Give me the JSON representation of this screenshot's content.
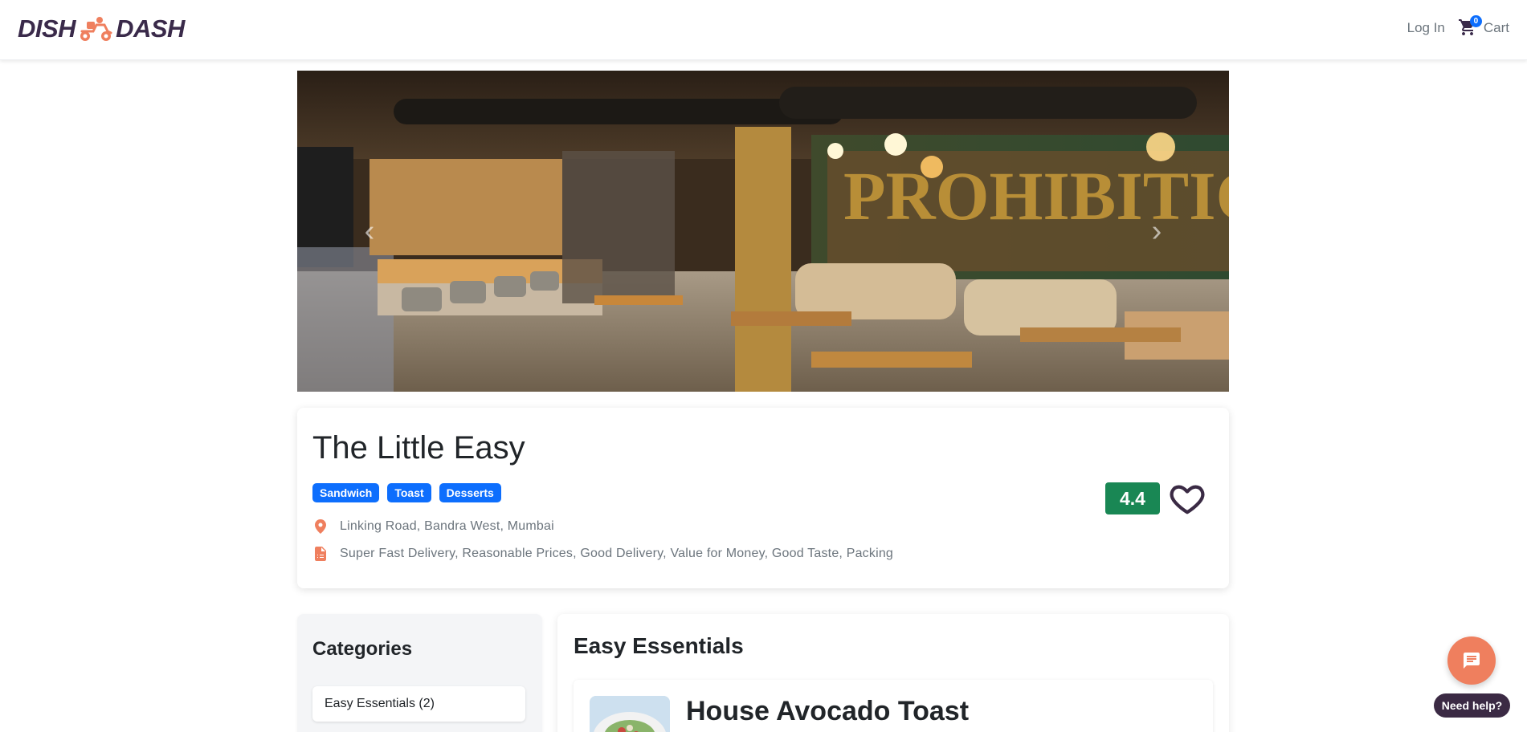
{
  "header": {
    "brand_left": "DISH",
    "brand_right": "DASH",
    "brand_icon": "scooter-icon",
    "login_label": "Log In",
    "cart_label": "Cart",
    "cart_count": "0"
  },
  "hero": {
    "prev_icon": "chevron-left-icon",
    "next_icon": "chevron-right-icon"
  },
  "restaurant": {
    "name": "The Little Easy",
    "tags": [
      "Sandwich",
      "Toast",
      "Desserts"
    ],
    "address": "Linking Road, Bandra West, Mumbai",
    "highlights": "Super Fast Delivery, Reasonable Prices, Good Delivery, Value for Money, Good Taste, Packing",
    "rating": "4.4",
    "rating_color": "#198754",
    "accent_color": "#ef7f5e"
  },
  "categories": {
    "title": "Categories",
    "items": [
      {
        "label": "Easy Essentials (2)"
      }
    ]
  },
  "menu": {
    "section_title": "Easy Essentials",
    "items": [
      {
        "name": "House Avocado Toast"
      }
    ]
  },
  "chat": {
    "help_label": "Need help?"
  }
}
